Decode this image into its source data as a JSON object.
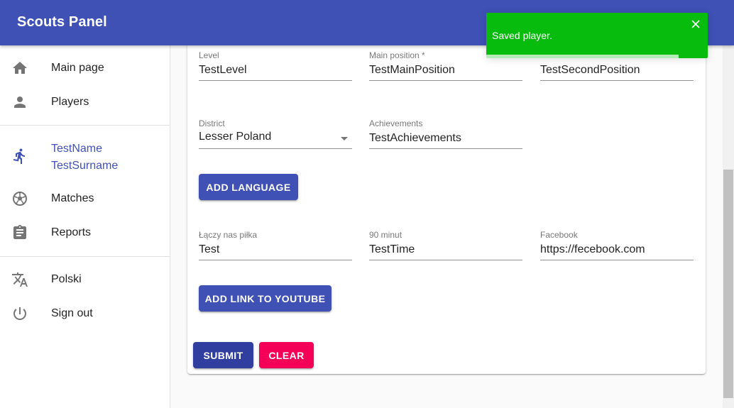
{
  "app": {
    "title": "Scouts Panel"
  },
  "sidebar": {
    "items": [
      {
        "label": "Main page",
        "icon": "home-icon"
      },
      {
        "label": "Players",
        "icon": "person-icon"
      }
    ],
    "player": {
      "first_name": "TestName",
      "last_name": "TestSurname",
      "icon": "running-icon"
    },
    "items2": [
      {
        "label": "Matches",
        "icon": "soccer-ball-icon"
      },
      {
        "label": "Reports",
        "icon": "clipboard-icon"
      }
    ],
    "items3": [
      {
        "label": "Polski",
        "icon": "translate-icon"
      },
      {
        "label": "Sign out",
        "icon": "power-icon"
      }
    ]
  },
  "form": {
    "level": {
      "label": "Level",
      "value": "TestLevel"
    },
    "main_position": {
      "label": "Main position *",
      "value": "TestMainPosition"
    },
    "second_position": {
      "value": "TestSecondPosition"
    },
    "district": {
      "label": "District",
      "value": "Lesser Poland"
    },
    "achievements": {
      "label": "Achievements",
      "value": "TestAchievements"
    },
    "add_language": "Add language",
    "laczy_nas_pilka": {
      "label": "Łączy nas piłka",
      "value": "Test"
    },
    "minut90": {
      "label": "90 minut",
      "value": "TestTime"
    },
    "facebook": {
      "label": "Facebook",
      "value": "https://fecebook.com"
    },
    "add_youtube": "Add link to youtube",
    "submit": "Submit",
    "clear": "Clear"
  },
  "toast": {
    "message": "Saved player.",
    "progress": 0.87
  },
  "colors": {
    "primary": "#3f51b5",
    "secondary": "#f50057",
    "success": "#07bc0c"
  }
}
